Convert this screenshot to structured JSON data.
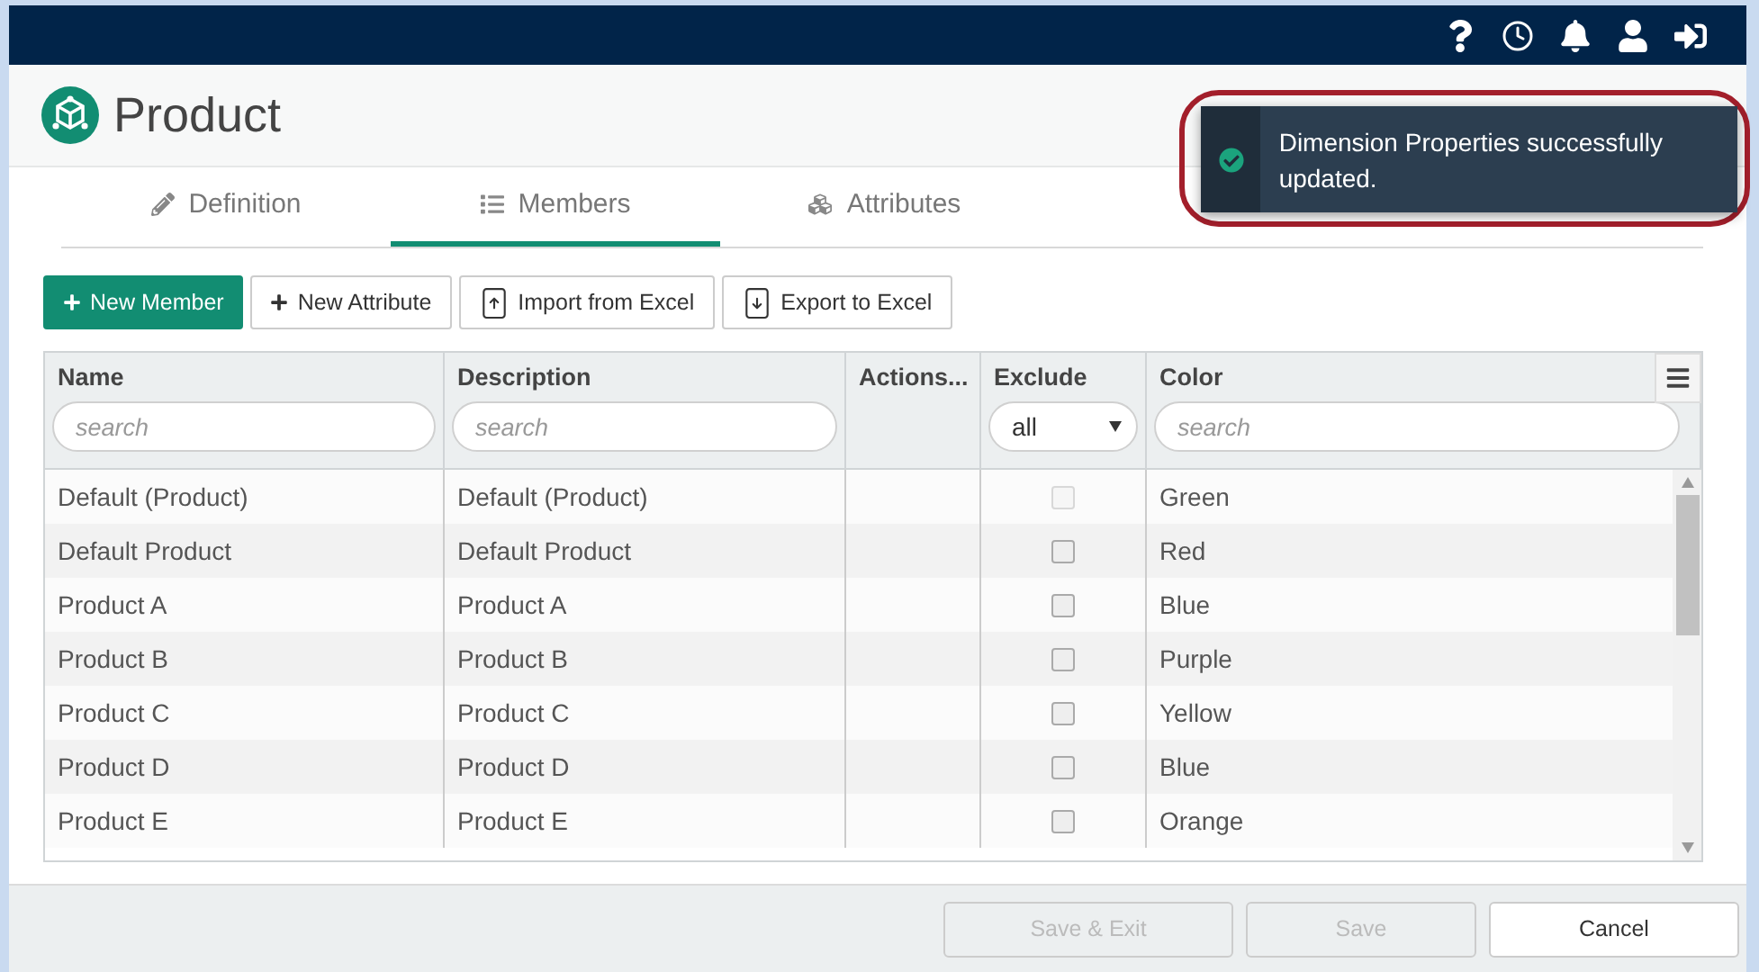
{
  "header": {
    "title": "Product"
  },
  "tabs": [
    {
      "label": "Definition",
      "selected": false
    },
    {
      "label": "Members",
      "selected": true
    },
    {
      "label": "Attributes",
      "selected": false
    }
  ],
  "toolbar": [
    {
      "label": "New Member",
      "primary": true
    },
    {
      "label": "New Attribute",
      "primary": false
    },
    {
      "label": "Import from Excel",
      "primary": false
    },
    {
      "label": "Export to Excel",
      "primary": false
    }
  ],
  "table": {
    "columns": [
      {
        "label": "Name",
        "kind": "search",
        "placeholder": "search"
      },
      {
        "label": "Description",
        "kind": "search",
        "placeholder": "search"
      },
      {
        "label": "Actions...",
        "kind": "plain"
      },
      {
        "label": "Exclude",
        "kind": "select",
        "value": "all"
      },
      {
        "label": "Color",
        "kind": "search",
        "placeholder": "search"
      }
    ],
    "rows": [
      {
        "name": "Default (Product)",
        "description": "Default (Product)",
        "exclude": false,
        "disabled": true,
        "color_name": "Green"
      },
      {
        "name": "Default Product",
        "description": "Default Product",
        "exclude": false,
        "disabled": false,
        "color_name": "Red"
      },
      {
        "name": "Product A",
        "description": "Product A",
        "exclude": false,
        "disabled": false,
        "color_name": "Blue"
      },
      {
        "name": "Product B",
        "description": "Product B",
        "exclude": false,
        "disabled": false,
        "color_name": "Purple"
      },
      {
        "name": "Product C",
        "description": "Product C",
        "exclude": false,
        "disabled": false,
        "color_name": "Yellow"
      },
      {
        "name": "Product D",
        "description": "Product D",
        "exclude": false,
        "disabled": false,
        "color_name": "Blue"
      },
      {
        "name": "Product E",
        "description": "Product E",
        "exclude": false,
        "disabled": false,
        "color_name": "Orange"
      }
    ]
  },
  "footer": {
    "buttons": [
      {
        "label": "Save & Exit",
        "disabled": true
      },
      {
        "label": "Save",
        "disabled": true
      },
      {
        "label": "Cancel",
        "disabled": false
      }
    ]
  },
  "toast": {
    "message": "Dimension Properties successfully updated.",
    "kind": "success"
  }
}
